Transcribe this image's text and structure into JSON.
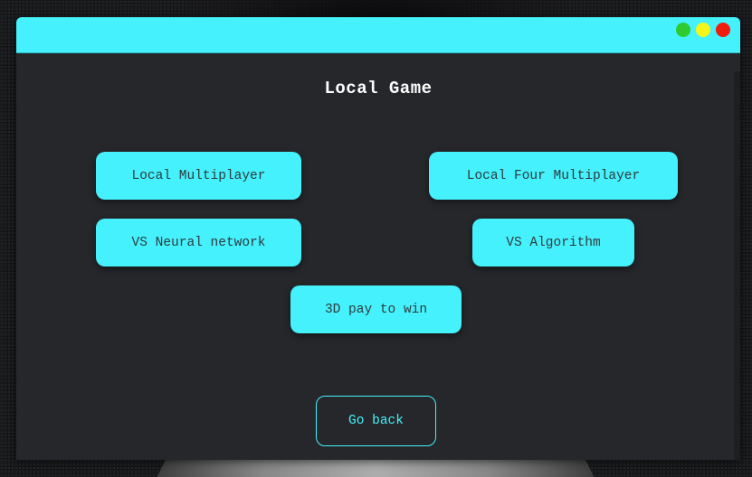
{
  "window": {
    "title": "Local Game",
    "controls": {
      "minimize_color": "#2fca2f",
      "maximize_color": "#f5f519",
      "close_color": "#f01d0f"
    },
    "accent_color": "#44f1fc",
    "panel_color": "#26272b"
  },
  "menu": {
    "local_multiplayer": "Local Multiplayer",
    "local_four_multiplayer": "Local Four Multiplayer",
    "vs_neural_network": "VS Neural network",
    "vs_algorithm": "VS Algorithm",
    "pay_to_win_3d": "3D pay to win",
    "go_back": "Go back"
  }
}
